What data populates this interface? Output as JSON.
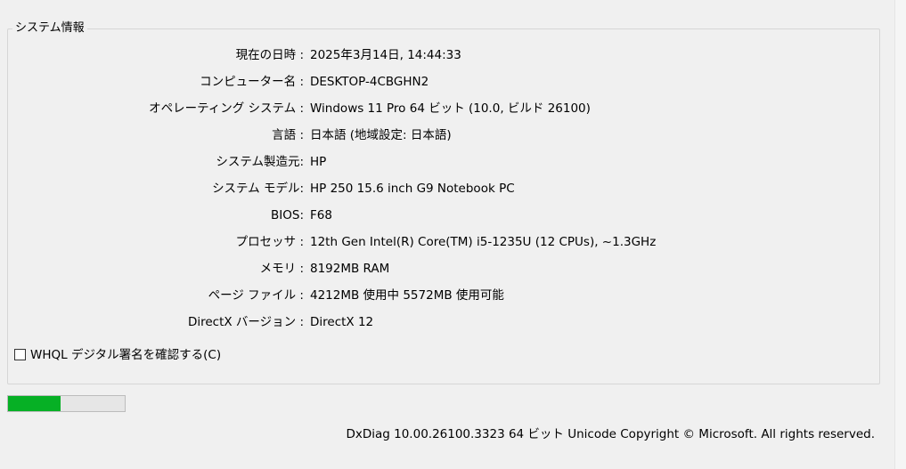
{
  "group": {
    "title": "システム情報"
  },
  "system_info": [
    {
      "label": "現在の日時 :",
      "value": "2025年3月14日, 14:44:33"
    },
    {
      "label": "コンピューター名 :",
      "value": "DESKTOP-4CBGHN2"
    },
    {
      "label": "オペレーティング システム :",
      "value": "Windows 11 Pro 64 ビット (10.0, ビルド 26100)"
    },
    {
      "label": "言語 :",
      "value": "日本語 (地域設定: 日本語)"
    },
    {
      "label": "システム製造元:",
      "value": "HP"
    },
    {
      "label": "システム モデル:",
      "value": "HP 250 15.6 inch G9 Notebook PC"
    },
    {
      "label": "BIOS:",
      "value": "F68"
    },
    {
      "label": "プロセッサ :",
      "value": "12th Gen Intel(R) Core(TM) i5-1235U (12 CPUs), ~1.3GHz"
    },
    {
      "label": "メモリ :",
      "value": "8192MB RAM"
    },
    {
      "label": "ページ ファイル :",
      "value": "4212MB 使用中 5572MB 使用可能"
    },
    {
      "label": "DirectX バージョン :",
      "value": "DirectX 12"
    }
  ],
  "whql_checkbox": {
    "label": "WHQL デジタル署名を確認する(C)",
    "checked": false
  },
  "progress": {
    "fraction": 0.45,
    "fill_color": "#06b025"
  },
  "footer": {
    "text": "DxDiag 10.00.26100.3323 64 ビット Unicode  Copyright © Microsoft. All rights reserved."
  }
}
